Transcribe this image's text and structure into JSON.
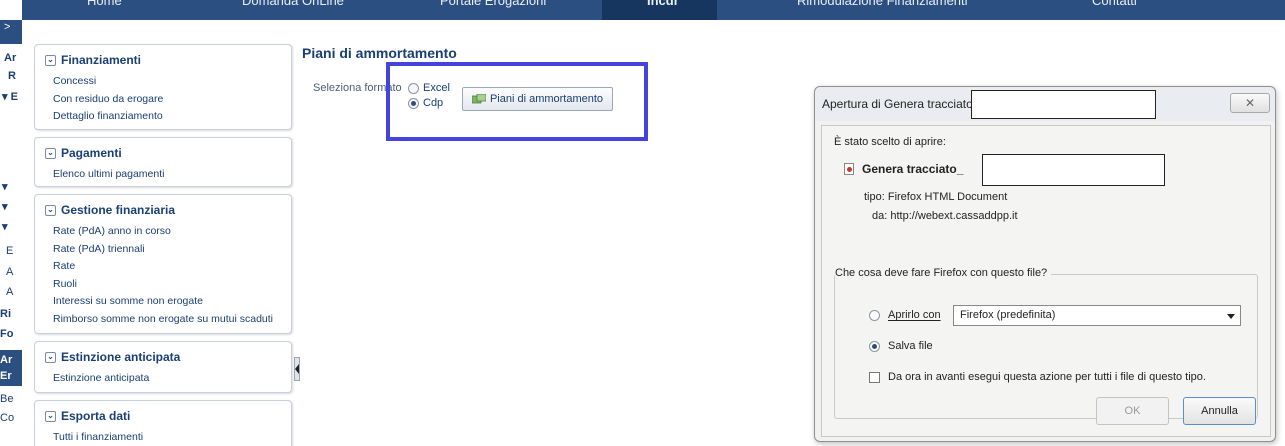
{
  "topnav": {
    "items": [
      "Home",
      "Domanda OnLine",
      "Portale Erogazioni",
      "Incdr",
      "Rimodulazione Finanziamenti",
      "Contatti"
    ],
    "active": "Incdr"
  },
  "leftstrip": {
    "fragments": [
      ">",
      "Ar",
      "R",
      "▾ E",
      "▾",
      "▾",
      "▾",
      "E",
      "A",
      "A",
      "Ri",
      "Fo",
      "Ar",
      "Er",
      "Be",
      "Co"
    ]
  },
  "sidebar": {
    "panels": [
      {
        "title": "Finanziamenti",
        "items": [
          "Concessi",
          "Con residuo da erogare",
          "Dettaglio finanziamento"
        ]
      },
      {
        "title": "Pagamenti",
        "items": [
          "Elenco ultimi pagamenti"
        ]
      },
      {
        "title": "Gestione finanziaria",
        "items": [
          "Rate (PdA) anno in corso",
          "Rate (PdA) triennali",
          "Rate",
          "Ruoli",
          "Interessi su somme non erogate",
          "Rimborso somme non erogate su mutui scaduti"
        ]
      },
      {
        "title": "Estinzione anticipata",
        "items": [
          "Estinzione anticipata"
        ]
      },
      {
        "title": "Esporta dati",
        "items": [
          "Tutti i finanziamenti"
        ]
      }
    ]
  },
  "main": {
    "title": "Piani di ammortamento",
    "format_label": "Seleziona formato",
    "format_options": [
      {
        "label": "Excel",
        "checked": false
      },
      {
        "label": "Cdp",
        "checked": true
      }
    ],
    "button_label": "Piani di ammortamento",
    "button_icon": "spreadsheet-icon"
  },
  "dialog": {
    "title": "Apertura di Genera tracciato",
    "close_glyph": "✕",
    "chosen_text": "È stato scelto di aprire:",
    "file_name": "Genera tracciato_",
    "type_label": "tipo:",
    "type_value": "Firefox HTML Document",
    "from_label": "da:",
    "from_value": "http://webext.cassaddpp.it",
    "question": "Che cosa deve fare Firefox con questo file?",
    "open_with_label": "Aprirlo con",
    "open_with_selected": false,
    "open_with_app": "Firefox (predefinita)",
    "save_label": "Salva file",
    "save_selected": true,
    "remember_label": "Da ora in avanti esegui questa azione per tutti i file di questo tipo.",
    "remember_checked": false,
    "ok_label": "OK",
    "cancel_label": "Annulla"
  },
  "colors": {
    "nav_bg": "#2b4f80",
    "link_text": "#1a3f73",
    "highlight_border": "#4444dd"
  }
}
